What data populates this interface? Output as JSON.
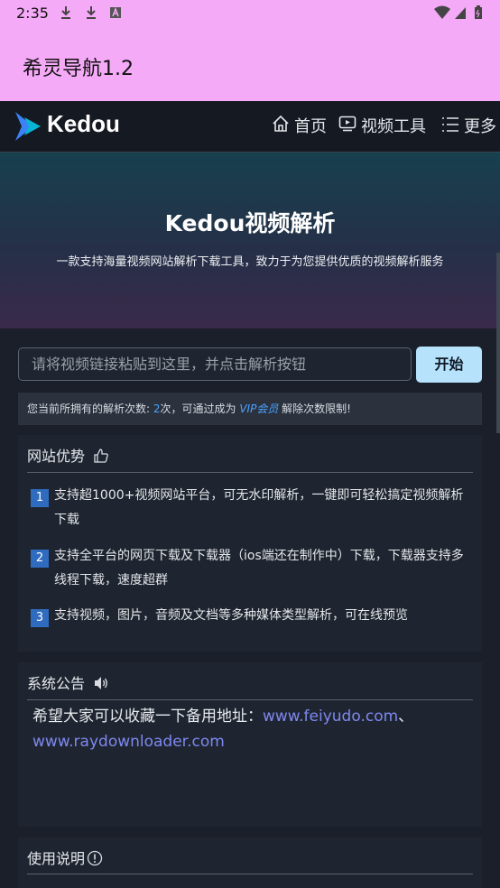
{
  "status_bar": {
    "time": "2:35"
  },
  "app_bar": {
    "title": "希灵导航1.2"
  },
  "site_nav": {
    "brand": "Kedou",
    "items": [
      {
        "label": "首页",
        "icon": "home-icon"
      },
      {
        "label": "视频工具",
        "icon": "video-icon"
      },
      {
        "label": "更多",
        "icon": "menu-lines-icon"
      }
    ]
  },
  "hero": {
    "title": "Kedou视频解析",
    "subtitle": "一款支持海量视频网站解析下载工具，致力于为您提供优质的视频解析服务"
  },
  "search": {
    "placeholder": "请将视频链接粘贴到这里，并点击解析按钮",
    "button_label": "开始"
  },
  "quota": {
    "prefix": "您当前所拥有的解析次数: ",
    "count": "2",
    "middle": "次，可通过成为 ",
    "vip": "VIP会员",
    "suffix": " 解除次数限制!"
  },
  "advantages": {
    "title": "网站优势",
    "items": [
      {
        "num": "1",
        "text": "支持超1000+视频网站平台，可无水印解析，一键即可轻松搞定视频解析下载"
      },
      {
        "num": "2",
        "text": "支持全平台的网页下载及下载器（ios端还在制作中）下载，下载器支持多线程下载，速度超群"
      },
      {
        "num": "3",
        "text": "支持视频，图片，音频及文档等多种媒体类型解析，可在线预览"
      }
    ]
  },
  "announcement": {
    "title": "系统公告",
    "text": "希望大家可以收藏一下备用地址：",
    "link1": "www.feiyudo.com",
    "sep": "、",
    "link2": "www.raydownloader.com"
  },
  "instructions": {
    "title": "使用说明"
  },
  "colors": {
    "app_bar": "#f5aaf7",
    "page_bg": "#1a1f29",
    "accent_blue": "#4aa2ff",
    "link": "#7d88f0",
    "start_button": "#b6e2fc"
  }
}
